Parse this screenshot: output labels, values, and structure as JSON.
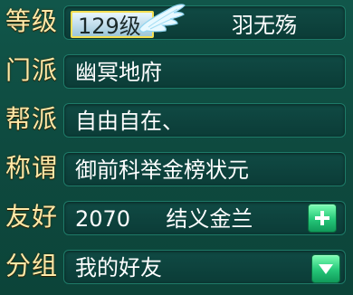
{
  "profile": {
    "level_label": "等级",
    "level_value": "129级",
    "name": "羽无殇",
    "sect_label": "门派",
    "sect_value": "幽冥地府",
    "guild_label": "帮派",
    "guild_value": "自由自在、",
    "title_label": "称谓",
    "title_value": "御前科举金榜状元",
    "friendship_label": "友好",
    "friendship_value": "2070",
    "relation_value": "结义金兰",
    "group_label": "分组",
    "group_value": "我的好友"
  },
  "icons": {
    "wing": "wing-icon",
    "add": "plus-icon",
    "dropdown": "chevron-down-icon"
  },
  "colors": {
    "label_text": "#ffe9a8",
    "value_text": "#ffffff",
    "level_border": "#f4df52",
    "button_green": "#25c678"
  }
}
